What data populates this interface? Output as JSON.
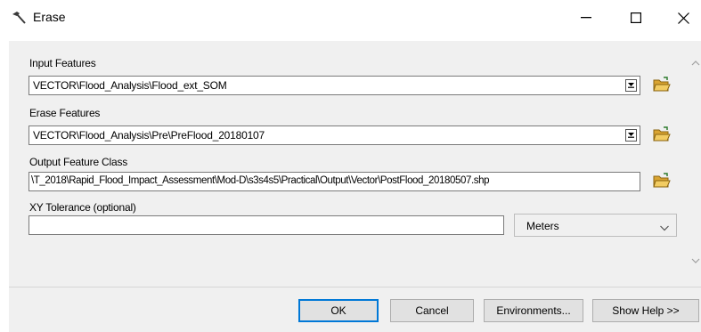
{
  "window": {
    "title": "Erase",
    "minimize_icon": "minimize-icon",
    "maximize_icon": "maximize-icon",
    "close_icon": "close-icon",
    "app_icon": "hammer-icon"
  },
  "form": {
    "input_features": {
      "label": "Input Features",
      "value": "VECTOR\\Flood_Analysis\\Flood_ext_SOM"
    },
    "erase_features": {
      "label": "Erase Features",
      "value": "VECTOR\\Flood_Analysis\\Pre\\PreFlood_20180107"
    },
    "output_feature_class": {
      "label": "Output Feature Class",
      "value": "\\T_2018\\Rapid_Flood_Impact_Assessment\\Mod-D\\s3s4s5\\Practical\\Output\\Vector\\PostFlood_20180507.shp"
    },
    "xy_tolerance": {
      "label": "XY Tolerance (optional)",
      "value": "",
      "units": "Meters"
    },
    "browse_icon": "folder-open-icon"
  },
  "footer": {
    "ok": "OK",
    "cancel": "Cancel",
    "environments": "Environments...",
    "show_help": "Show Help >>"
  },
  "colors": {
    "panel": "#f0f0f0",
    "primary_border": "#0078d7",
    "folder": "#e8b84a"
  }
}
